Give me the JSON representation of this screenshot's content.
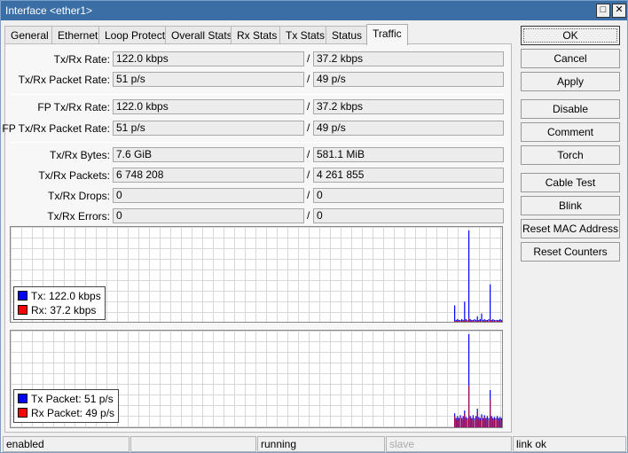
{
  "window": {
    "title": "Interface <ether1>",
    "maximize_glyph": "□",
    "close_glyph": "✕"
  },
  "tabs": [
    {
      "label": "General"
    },
    {
      "label": "Ethernet"
    },
    {
      "label": "Loop Protect"
    },
    {
      "label": "Overall Stats"
    },
    {
      "label": "Rx Stats"
    },
    {
      "label": "Tx Stats"
    },
    {
      "label": "Status"
    },
    {
      "label": "Traffic"
    }
  ],
  "active_tab": "Traffic",
  "fields": {
    "txrx_rate": {
      "label": "Tx/Rx Rate:",
      "tx": "122.0 kbps",
      "rx": "37.2 kbps"
    },
    "txrx_packet_rate": {
      "label": "Tx/Rx Packet Rate:",
      "tx": "51 p/s",
      "rx": "49 p/s"
    },
    "fp_txrx_rate": {
      "label": "FP Tx/Rx Rate:",
      "tx": "122.0 kbps",
      "rx": "37.2 kbps"
    },
    "fp_txrx_packet_rate": {
      "label": "FP Tx/Rx Packet Rate:",
      "tx": "51 p/s",
      "rx": "49 p/s"
    },
    "txrx_bytes": {
      "label": "Tx/Rx Bytes:",
      "tx": "7.6 GiB",
      "rx": "581.1 MiB"
    },
    "txrx_packets": {
      "label": "Tx/Rx Packets:",
      "tx": "6 748 208",
      "rx": "4 261 855"
    },
    "txrx_drops": {
      "label": "Tx/Rx Drops:",
      "tx": "0",
      "rx": "0"
    },
    "txrx_errors": {
      "label": "Tx/Rx Errors:",
      "tx": "0",
      "rx": "0"
    },
    "slash": "/"
  },
  "graph_rate": {
    "legend": [
      {
        "label": "Tx:  122.0 kbps",
        "color": "#0000ff"
      },
      {
        "label": "Rx:  37.2 kbps",
        "color": "#ff0000"
      }
    ],
    "tx_values": [
      0,
      0,
      0,
      0,
      0,
      0,
      0,
      0,
      0,
      0,
      0,
      0,
      0,
      0,
      0,
      0.18,
      0.02,
      0.03,
      0.02,
      0.02,
      0.03,
      0.02,
      0.22,
      0.03,
      0.02,
      1.0,
      0.03,
      0.02,
      0.02,
      0.03,
      0.02,
      0.06,
      0.02,
      0.03,
      0.09,
      0.02,
      0.03,
      0.02,
      0.02,
      0.03,
      0.41,
      0.02,
      0.03,
      0.02,
      0.02,
      0.02,
      0.02,
      0.03,
      0.02,
      0.02
    ],
    "rx_values": [
      0,
      0,
      0,
      0,
      0,
      0,
      0,
      0,
      0,
      0,
      0,
      0,
      0,
      0,
      0,
      0.01,
      0.01,
      0.01,
      0.01,
      0.01,
      0.01,
      0.01,
      0.02,
      0.01,
      0.01,
      0.04,
      0.01,
      0.01,
      0.01,
      0.01,
      0.01,
      0.01,
      0.01,
      0.01,
      0.01,
      0.01,
      0.01,
      0.01,
      0.01,
      0.01,
      0.03,
      0.01,
      0.01,
      0.01,
      0.01,
      0.01,
      0.01,
      0.01,
      0.01,
      0.01
    ]
  },
  "graph_packets": {
    "legend": [
      {
        "label": "Tx Packet:  51 p/s",
        "color": "#0000ff"
      },
      {
        "label": "Rx Packet:  49 p/s",
        "color": "#ff0000"
      }
    ],
    "tx_values": [
      0,
      0,
      0,
      0,
      0,
      0,
      0,
      0,
      0,
      0,
      0,
      0,
      0,
      0,
      0,
      0.15,
      0.1,
      0.12,
      0.1,
      0.13,
      0.1,
      0.12,
      0.18,
      0.11,
      0.1,
      1.0,
      0.12,
      0.1,
      0.13,
      0.1,
      0.12,
      0.2,
      0.11,
      0.1,
      0.14,
      0.1,
      0.13,
      0.1,
      0.12,
      0.1,
      0.4,
      0.12,
      0.1,
      0.11,
      0.1,
      0.12,
      0.1,
      0.11,
      0.1,
      0.12
    ],
    "rx_values": [
      0,
      0,
      0,
      0,
      0,
      0,
      0,
      0,
      0,
      0,
      0,
      0,
      0,
      0,
      0,
      0.12,
      0.08,
      0.1,
      0.08,
      0.11,
      0.08,
      0.1,
      0.15,
      0.09,
      0.08,
      0.45,
      0.1,
      0.08,
      0.11,
      0.08,
      0.1,
      0.16,
      0.09,
      0.08,
      0.12,
      0.08,
      0.11,
      0.08,
      0.1,
      0.08,
      0.3,
      0.1,
      0.08,
      0.09,
      0.08,
      0.1,
      0.08,
      0.09,
      0.08,
      0.1
    ]
  },
  "buttons": {
    "ok": "OK",
    "cancel": "Cancel",
    "apply": "Apply",
    "disable": "Disable",
    "comment": "Comment",
    "torch": "Torch",
    "cable_test": "Cable Test",
    "blink": "Blink",
    "reset_mac": "Reset MAC Address",
    "reset_counters": "Reset Counters"
  },
  "status": {
    "state": "enabled",
    "empty": "",
    "running": "running",
    "slave": "slave",
    "link": "link ok"
  }
}
